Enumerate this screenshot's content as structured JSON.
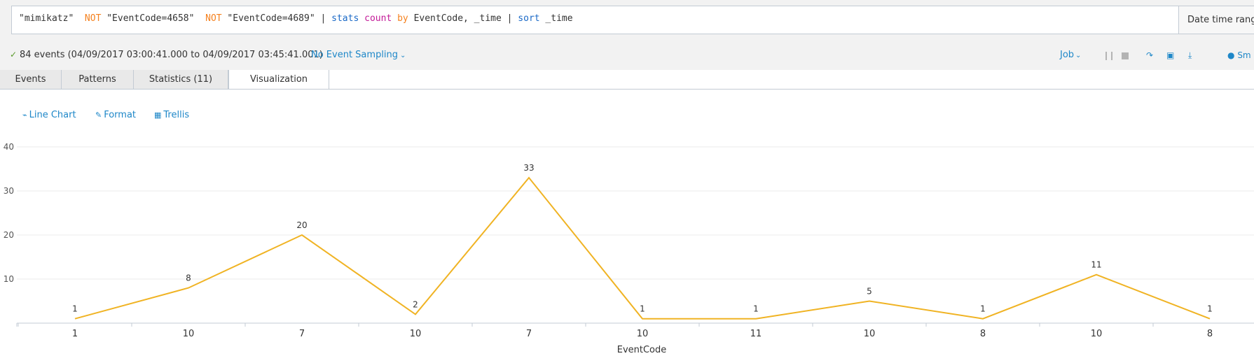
{
  "search": {
    "query_parts": [
      {
        "text": "\"mimikatz\"  ",
        "kind": "str"
      },
      {
        "text": "NOT",
        "kind": "op"
      },
      {
        "text": " \"EventCode=4658\"  ",
        "kind": "str"
      },
      {
        "text": "NOT",
        "kind": "op"
      },
      {
        "text": " \"EventCode=4689\" ",
        "kind": "str"
      },
      {
        "text": "| ",
        "kind": "pipe"
      },
      {
        "text": "stats",
        "kind": "cmd"
      },
      {
        "text": " ",
        "kind": "str"
      },
      {
        "text": "count",
        "kind": "fn"
      },
      {
        "text": " ",
        "kind": "str"
      },
      {
        "text": "by",
        "kind": "by"
      },
      {
        "text": " EventCode, _time ",
        "kind": "field"
      },
      {
        "text": "| ",
        "kind": "pipe"
      },
      {
        "text": "sort",
        "kind": "cmd"
      },
      {
        "text": " _time",
        "kind": "field"
      }
    ],
    "time_range_label": "Date time range"
  },
  "status": {
    "summary": "84 events (04/09/2017 03:00:41.000 to 04/09/2017 03:45:41.001)",
    "sampling": "No Event Sampling",
    "job": "Job",
    "smart_label": "Sm"
  },
  "tabs": [
    {
      "label": "Events"
    },
    {
      "label": "Patterns"
    },
    {
      "label": "Statistics (11)"
    },
    {
      "label": "Visualization"
    }
  ],
  "viz_tools": {
    "chart_type": "Line Chart",
    "format": "Format",
    "trellis": "Trellis"
  },
  "colors": {
    "accent": "#1e87c8",
    "series_line": "#f0b323",
    "operator": "#f58220",
    "command": "#1a69c7",
    "function": "#c31b98"
  },
  "chart_data": {
    "type": "line",
    "categories": [
      "1",
      "10",
      "7",
      "10",
      "7",
      "10",
      "11",
      "10",
      "8",
      "10",
      "8"
    ],
    "series": [
      {
        "values": [
          1,
          8,
          20,
          2,
          33,
          1,
          1,
          5,
          1,
          11,
          1
        ]
      }
    ],
    "data_labels": true,
    "xlabel": "EventCode",
    "ylabel": "",
    "ylim": [
      0,
      40
    ],
    "yticks": [
      10,
      20,
      30,
      40
    ],
    "grid": true,
    "legend": "none"
  }
}
